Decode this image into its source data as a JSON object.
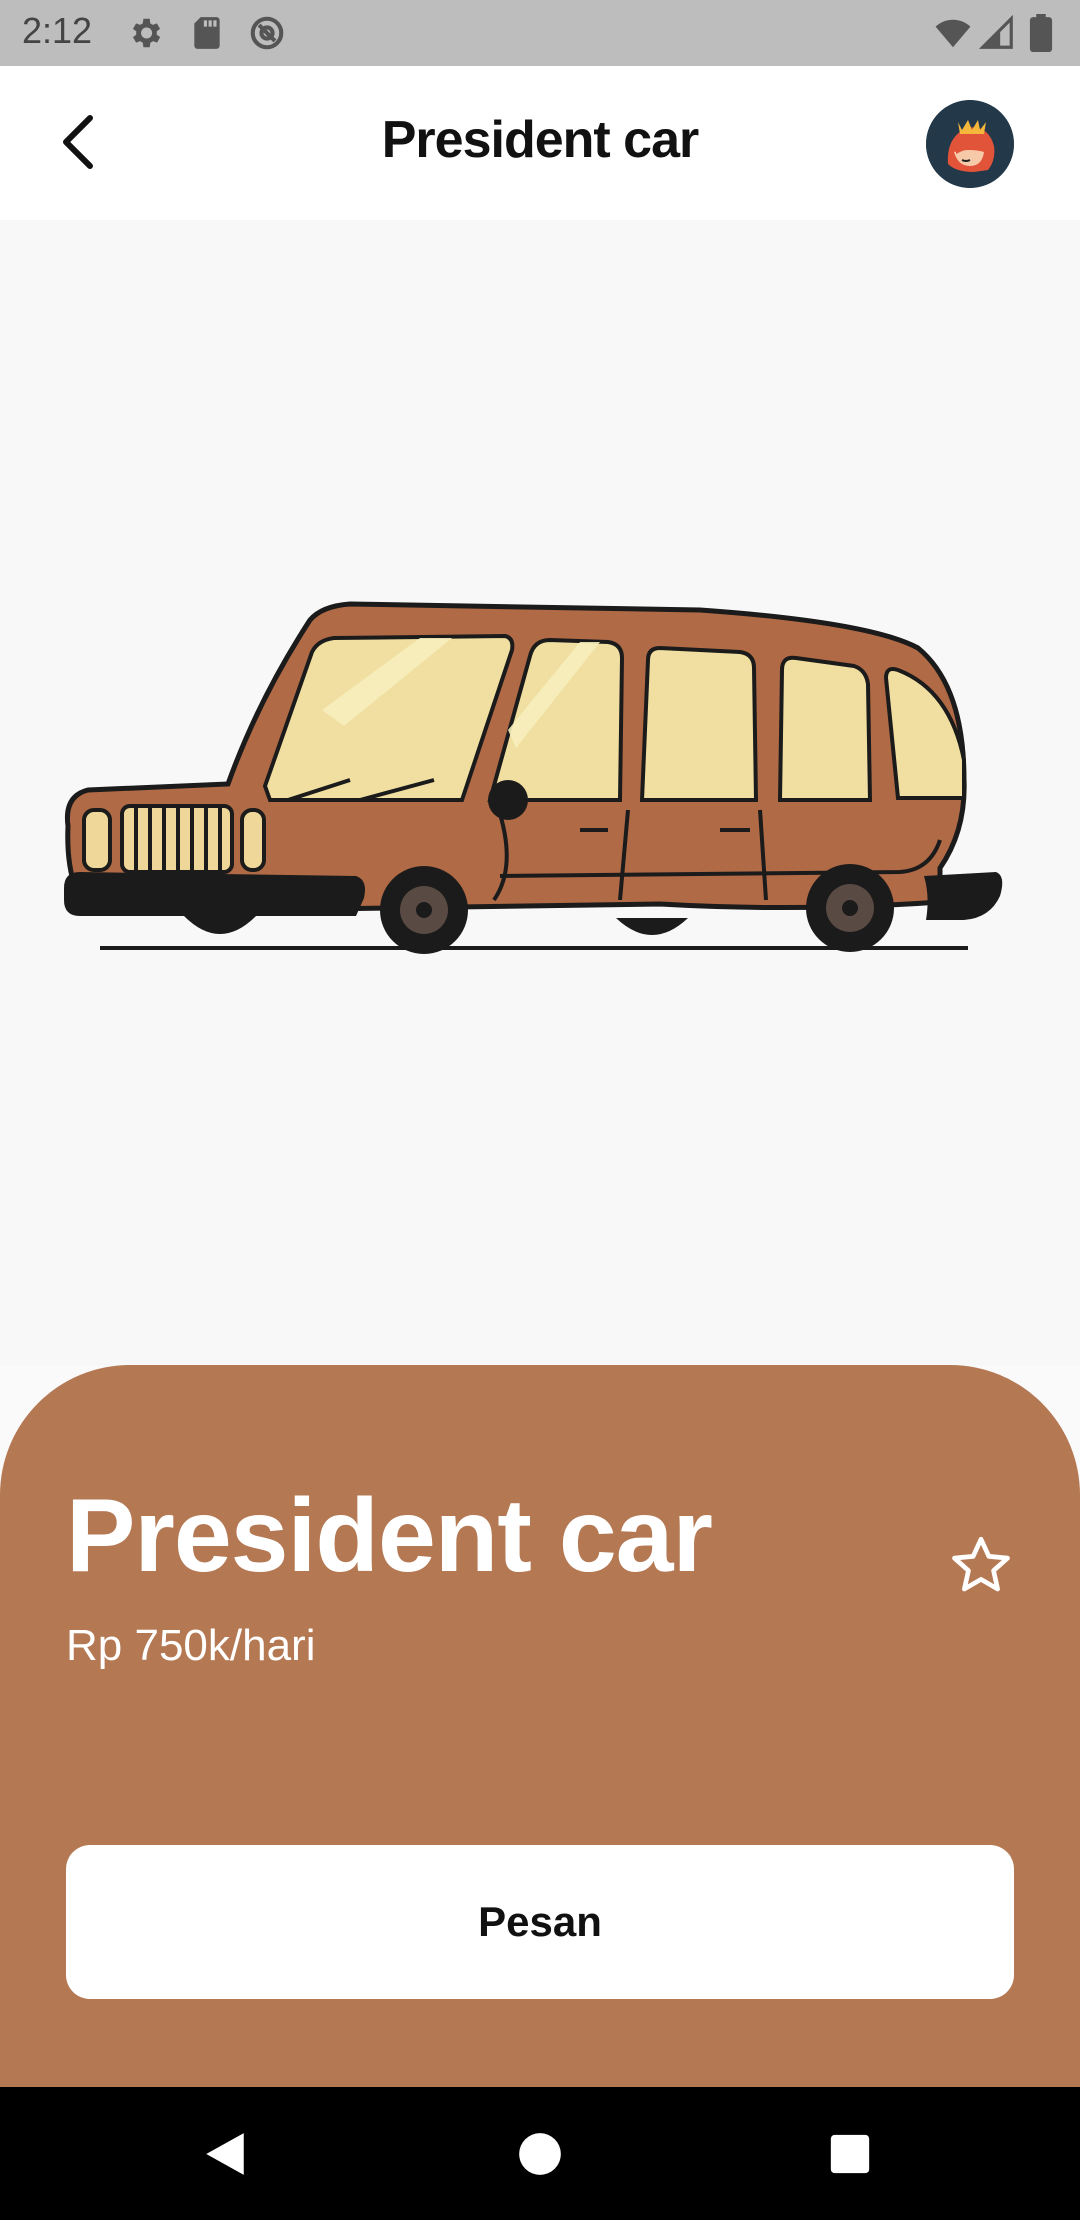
{
  "status_bar": {
    "time": "2:12",
    "left_icons": [
      "gear-icon",
      "sd-card-icon",
      "at-sign-icon"
    ],
    "right_icons": [
      "wifi-icon",
      "signal-icon",
      "battery-icon"
    ]
  },
  "app_bar": {
    "title": "President car",
    "back_icon": "chevron-left-icon",
    "avatar_icon": "avatar"
  },
  "hero": {
    "image": "car-illustration",
    "car_color": "#b06a45"
  },
  "detail": {
    "name": "President car",
    "price": "Rp 750k/hari",
    "favorite_icon": "star-outline-icon",
    "order_button_label": "Pesan",
    "sheet_color": "#b47853"
  },
  "nav_bar": {
    "icons": [
      "back-triangle-icon",
      "home-circle-icon",
      "recents-square-icon"
    ]
  }
}
